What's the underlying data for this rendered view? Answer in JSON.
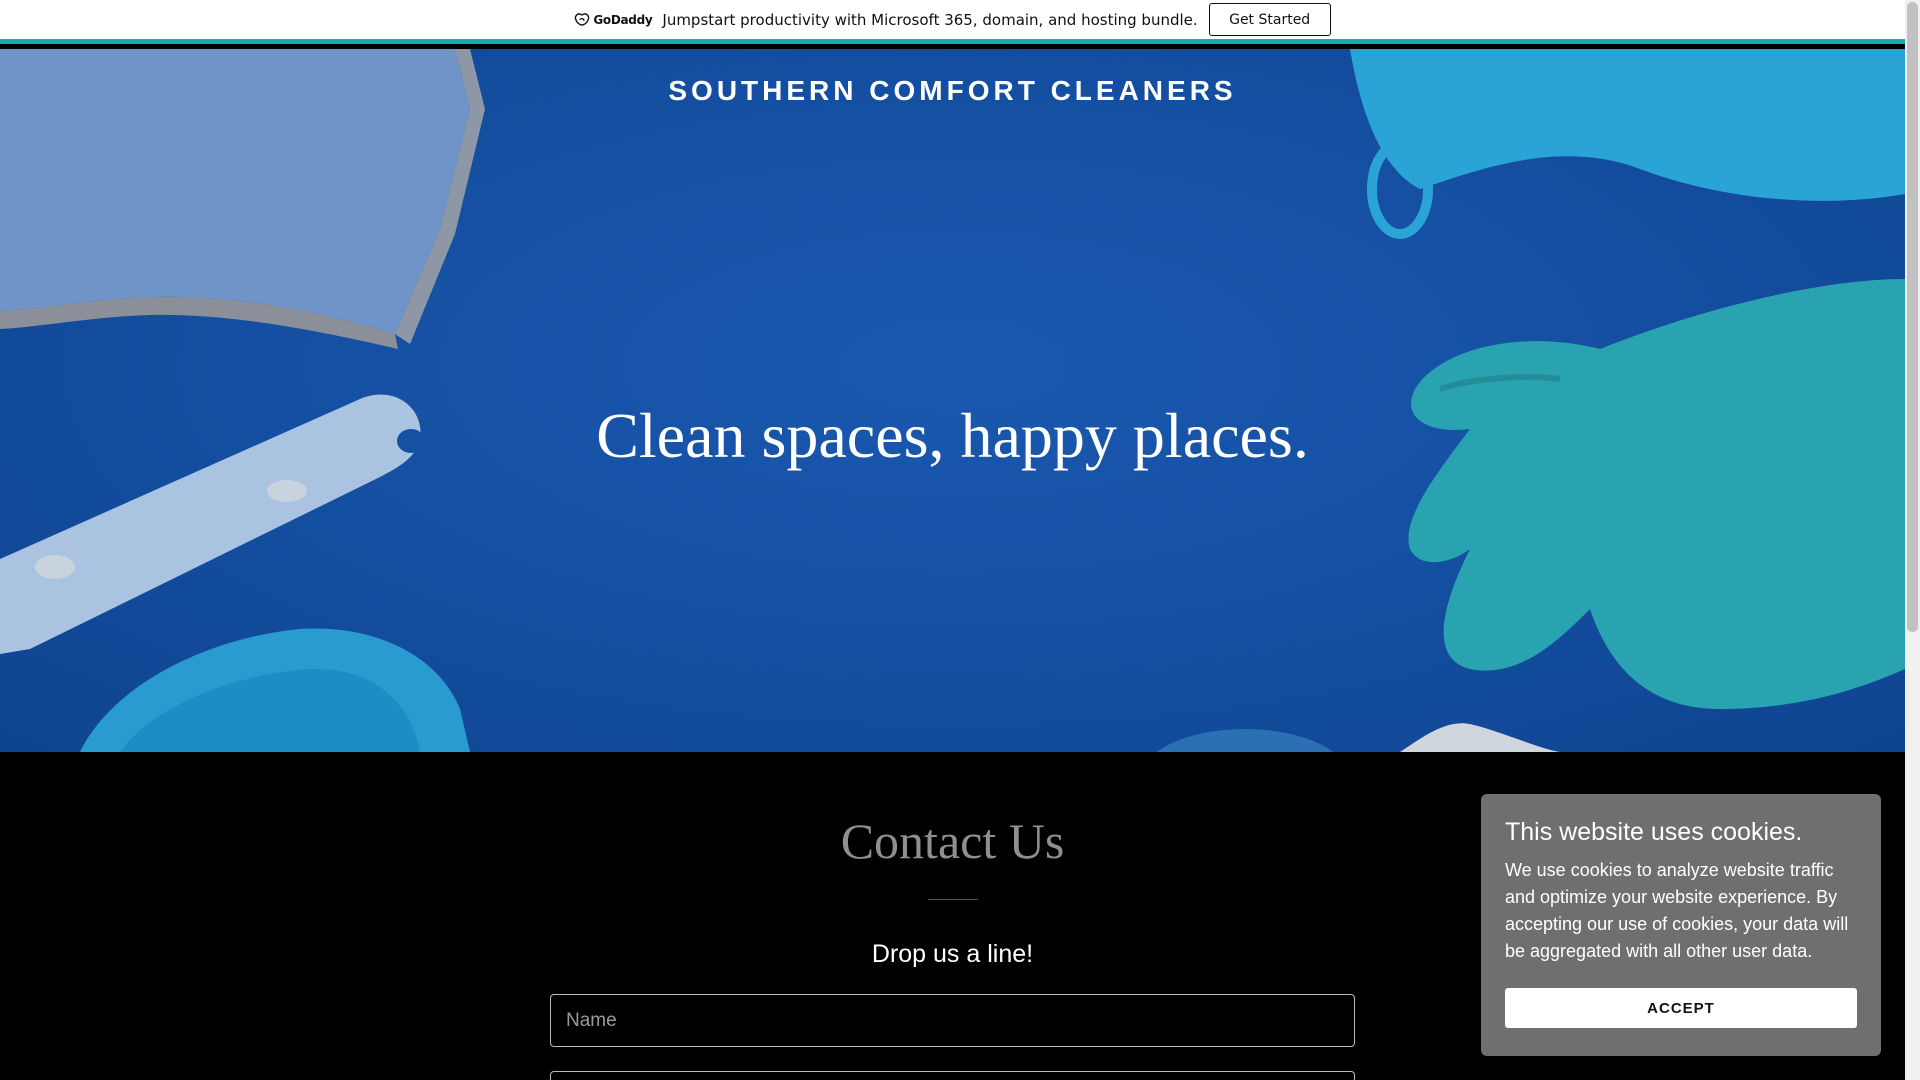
{
  "promo": {
    "logo_text": "GoDaddy",
    "message": "Jumpstart productivity with Microsoft 365, domain, and hosting bundle.",
    "cta_label": "Get Started",
    "accent_color": "#1aa7b0"
  },
  "hero": {
    "brand": "SOUTHERN COMFORT CLEANERS",
    "tagline": "Clean spaces, happy places.",
    "background_color": "#1550a3"
  },
  "contact": {
    "title": "Contact Us",
    "subtitle": "Drop us a line!",
    "name_placeholder": "Name",
    "email_placeholder": ""
  },
  "cookie_banner": {
    "title": "This website uses cookies.",
    "body": "We use cookies to analyze website traffic and optimize your website experience. By accepting our use of cookies, your data will be aggregated with all other user data.",
    "accept_label": "ACCEPT"
  }
}
